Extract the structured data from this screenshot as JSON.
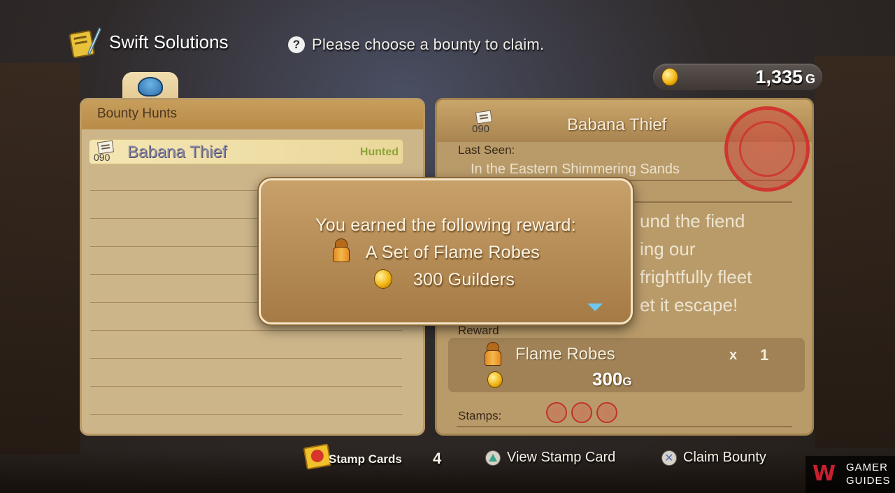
{
  "header": {
    "title": "Swift Solutions",
    "help_icon": "question-circle-icon",
    "help_text": "Please choose a bounty to claim."
  },
  "gold": {
    "amount": "1,335",
    "unit": "G"
  },
  "left_panel": {
    "heading": "Bounty Hunts",
    "bounties": [
      {
        "number": "090",
        "name": "Babana Thief",
        "status": "Hunted"
      }
    ]
  },
  "detail": {
    "number": "090",
    "title": "Babana Thief",
    "last_seen_label": "Last Seen:",
    "last_seen_value": "In the Eastern Shimmering Sands",
    "description_lines": [
      "und the fiend",
      "ing our",
      "frightfully fleet",
      "et it escape!"
    ],
    "reward_label": "Reward",
    "reward_item": "Flame Robes",
    "reward_x": "x",
    "reward_qty": "1",
    "reward_gold": "300",
    "reward_gold_unit": "G",
    "stamps_label": "Stamps:",
    "stamps_count": 3
  },
  "popup": {
    "line1": "You earned the following reward:",
    "line2": "A Set of Flame Robes",
    "line3": "300 Guilders"
  },
  "footer": {
    "stamp_cards_label": "Stamp Cards",
    "stamp_cards_count": "4",
    "view_label": "View Stamp Card",
    "claim_label": "Claim Bounty"
  },
  "watermark": {
    "line1": "GAMER",
    "line2": "GUIDES"
  },
  "colors": {
    "hunted": "#8da43a",
    "stamp_red": "#c2312a",
    "coin": "#f2b612"
  }
}
